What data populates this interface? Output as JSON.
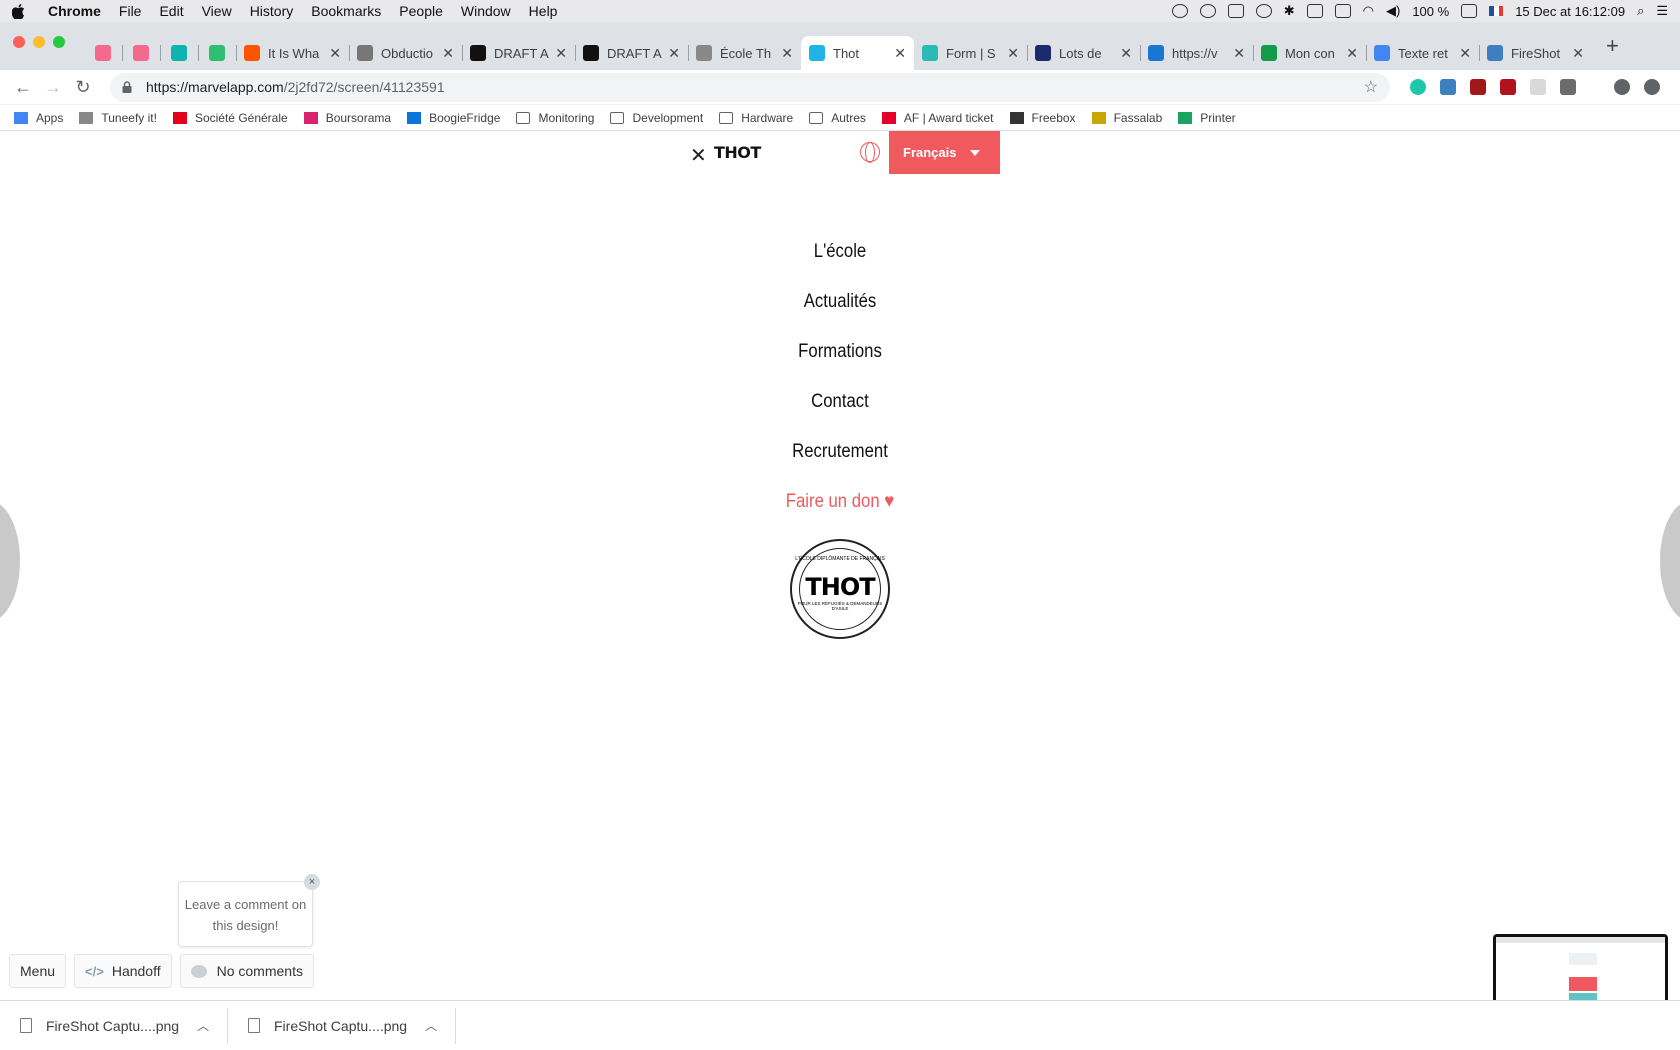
{
  "menubar": {
    "app": "Chrome",
    "items": [
      "File",
      "Edit",
      "View",
      "History",
      "Bookmarks",
      "People",
      "Window",
      "Help"
    ],
    "battery": "100 %",
    "datetime": "15 Dec at  16:12:09"
  },
  "tabs": [
    {
      "title": "",
      "icon": "k-icon",
      "color": "#f46a8c"
    },
    {
      "title": "",
      "icon": "k-icon",
      "color": "#f46a8c"
    },
    {
      "title": "",
      "icon": "trello-icon",
      "color": "#0fb3b0"
    },
    {
      "title": "",
      "icon": "trello-icon",
      "color": "#2fbf71"
    },
    {
      "title": "It Is Wha",
      "icon": "soundcloud-icon",
      "color": "#ff5500"
    },
    {
      "title": "Obductio",
      "icon": "diamond-icon",
      "color": "#777777"
    },
    {
      "title": "DRAFT A",
      "icon": "r-icon",
      "color": "#111111"
    },
    {
      "title": "DRAFT A",
      "icon": "r-icon",
      "color": "#111111"
    },
    {
      "title": "École Th",
      "icon": "doc-icon",
      "color": "#888888"
    },
    {
      "title": "Thot",
      "icon": "marvel-icon",
      "color": "#1fb3e6",
      "active": true
    },
    {
      "title": "Form | S",
      "icon": "s-icon",
      "color": "#2bbab4"
    },
    {
      "title": "Lots de",
      "icon": "gg-icon",
      "color": "#1a2a6c"
    },
    {
      "title": "https://v",
      "icon": "m-icon",
      "color": "#1976d2"
    },
    {
      "title": "Mon con",
      "icon": "k-icon",
      "color": "#129c4a"
    },
    {
      "title": "Texte ret",
      "icon": "docs-icon",
      "color": "#4285f4"
    },
    {
      "title": "FireShot",
      "icon": "fireshot-icon",
      "color": "#3d7fbf"
    }
  ],
  "url": {
    "host": "https://marvelapp.com",
    "path": "/2j2fd72/screen/41123591"
  },
  "bookmarks": [
    {
      "label": "Apps",
      "icon": "apps-grid-icon"
    },
    {
      "label": "Tuneefy it!",
      "icon": "page-icon"
    },
    {
      "label": "Société Générale",
      "icon": "sg-icon"
    },
    {
      "label": "Boursorama",
      "icon": "boursorama-icon"
    },
    {
      "label": "BoogieFridge",
      "icon": "dsm-icon"
    },
    {
      "label": "Monitoring",
      "icon": "folder-icon"
    },
    {
      "label": "Development",
      "icon": "folder-icon"
    },
    {
      "label": "Hardware",
      "icon": "folder-icon"
    },
    {
      "label": "Autres",
      "icon": "folder-icon"
    },
    {
      "label": "AF | Award ticket",
      "icon": "af-icon"
    },
    {
      "label": "Freebox",
      "icon": "freebox-icon"
    },
    {
      "label": "Fassalab",
      "icon": "fassalab-icon"
    },
    {
      "label": "Printer",
      "icon": "hp-icon"
    }
  ],
  "site": {
    "logo": "THOT",
    "language": "Français",
    "nav": [
      "L'école",
      "Actualités",
      "Formations",
      "Contact",
      "Recrutement"
    ],
    "donate": "Faire un don",
    "seal": {
      "top": "L'ÉCOLE DIPLÔMANTE DE FRANÇAIS",
      "name": "THOT",
      "bottom": "POUR LES RÉFUGIÉS & DEMANDEURS D'ASILE"
    }
  },
  "marvel": {
    "tooltip": "Leave a comment on this design!",
    "menu": "Menu",
    "handoff": "Handoff",
    "comments": "No comments"
  },
  "downloads": [
    {
      "name": "FireShot Captu....png"
    },
    {
      "name": "FireShot Captu....png"
    }
  ],
  "colors": {
    "brand": "#f05a5e"
  }
}
